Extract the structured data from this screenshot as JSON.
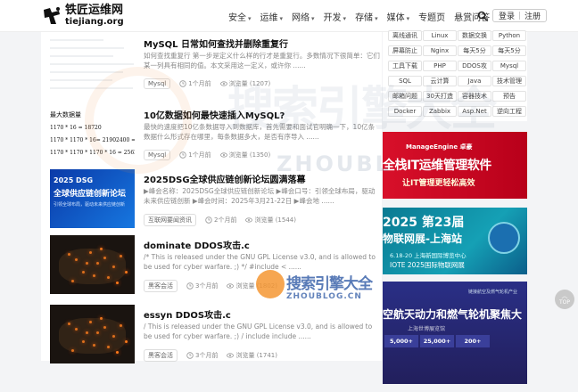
{
  "site": {
    "name": "铁匠运维网",
    "domain": "tiejiang.org"
  },
  "nav": [
    {
      "label": "安全",
      "has_dropdown": true
    },
    {
      "label": "运维",
      "has_dropdown": true
    },
    {
      "label": "网络",
      "has_dropdown": true
    },
    {
      "label": "开发",
      "has_dropdown": true
    },
    {
      "label": "存储",
      "has_dropdown": true
    },
    {
      "label": "媒体",
      "has_dropdown": true
    },
    {
      "label": "专题页",
      "has_dropdown": false
    },
    {
      "label": "悬赏问答",
      "has_dropdown": false
    }
  ],
  "auth": {
    "login": "登录",
    "separator": "|",
    "register": "注册"
  },
  "posts": [
    {
      "title": "MySQL 日常如何查找并删除重复行",
      "excerpt": "如何查找重复行 第一步是定义什么样的行才是重复行。多数情况下很简单：它们某一列具有相同的值。本文采用这一定义，或许你 ......",
      "tag": "Mysql",
      "time": "1个月前",
      "views": "浏览量 (1207)",
      "thumb": {
        "type": "lines"
      }
    },
    {
      "title": "10亿数据如何最快速插入MySQL?",
      "excerpt": "最快的速度把10亿条数据导入到数据库，首先需要和面试官明确一下，10亿条数据什么形式存在哪里，每条数据多大，是否有序导入 ......",
      "tag": "Mysql",
      "time": "1个月前",
      "views": "浏览量 (1350)",
      "thumb": {
        "type": "math",
        "heading": "最大数据量",
        "lines": [
          "1170 * 16 = 18720",
          "1170 * 1170 * 16= 21902400 =",
          "1170 * 1170 * 1170 * 16 = 2562"
        ]
      }
    },
    {
      "title": "2025DSG全球供应链创新论坛圆满落幕",
      "excerpt": "▶峰会名称：2025DSG全球供应链创新论坛 ▶峰会口号：引领全球布局，驱动未来供应链创新 ▶峰会时间：2025年3月21-22日 ▶峰会地 ......",
      "tag": "互联网要闻资讯",
      "time": "2个月前",
      "views": "浏览量 (1544)",
      "thumb": {
        "type": "banner",
        "year": "2025 DSG",
        "line1": "全球供应链创新论坛",
        "line2": "引领全球布局，驱动未来供应链创新"
      }
    },
    {
      "title": "dominate DDOS攻击.c",
      "excerpt": "/* This is released under the GNU GPL License v3.0, and is allowed to be used for cyber warfare. ;) */ #include < ......",
      "tag": "黑客会活",
      "time": "3个月前",
      "views": "浏览量 (1802)",
      "thumb": {
        "type": "map"
      }
    },
    {
      "title": "essyn DDOS攻击.c",
      "excerpt": "/ This is released under the GNU GPL License v3.0, and is allowed to be used for cyber warfare. ;) / include include ......",
      "tag": "黑客会活",
      "time": "3个月前",
      "views": "浏览量 (1741)",
      "thumb": {
        "type": "map"
      }
    }
  ],
  "sidebar": {
    "tags": [
      "离线通讯",
      "Linux",
      "数据交换",
      "Python",
      "屏幕防止",
      "Nginx",
      "每天5分",
      "每天5分",
      "工具下载",
      "PHP",
      "DDOS攻",
      "Mysql",
      "SQL",
      "云计算",
      "Java",
      "技术管理",
      "邮箱问题",
      "30天打造",
      "容器技术",
      "预告",
      "Docker",
      "Zabbix",
      "Asp.Net",
      "逆向工程"
    ],
    "ads": [
      {
        "brand": "ManageEngine 卓豪",
        "title": "全栈IT运维管理软件",
        "subtitle": "让IT管理更轻松高效"
      },
      {
        "title": "2025 第23届",
        "subtitle": "物联网展-上海站",
        "date": "6.18-20 上海新国际博览中心",
        "caption": "IOTE 2025国际物联网展"
      },
      {
        "small": "链接航空及燃气轮机产业",
        "title": "空航天动力和燃气轮机聚焦大",
        "venue": "上海世博展览馆",
        "stats": [
          "5,000+",
          "25,000+",
          "200+"
        ]
      }
    ]
  },
  "watermark": {
    "text": "搜索引擎大全",
    "domain": "ZHOUBLOG.CN",
    "domain_short": "ZHOUBL"
  },
  "gotop": {
    "label": "TOP"
  }
}
